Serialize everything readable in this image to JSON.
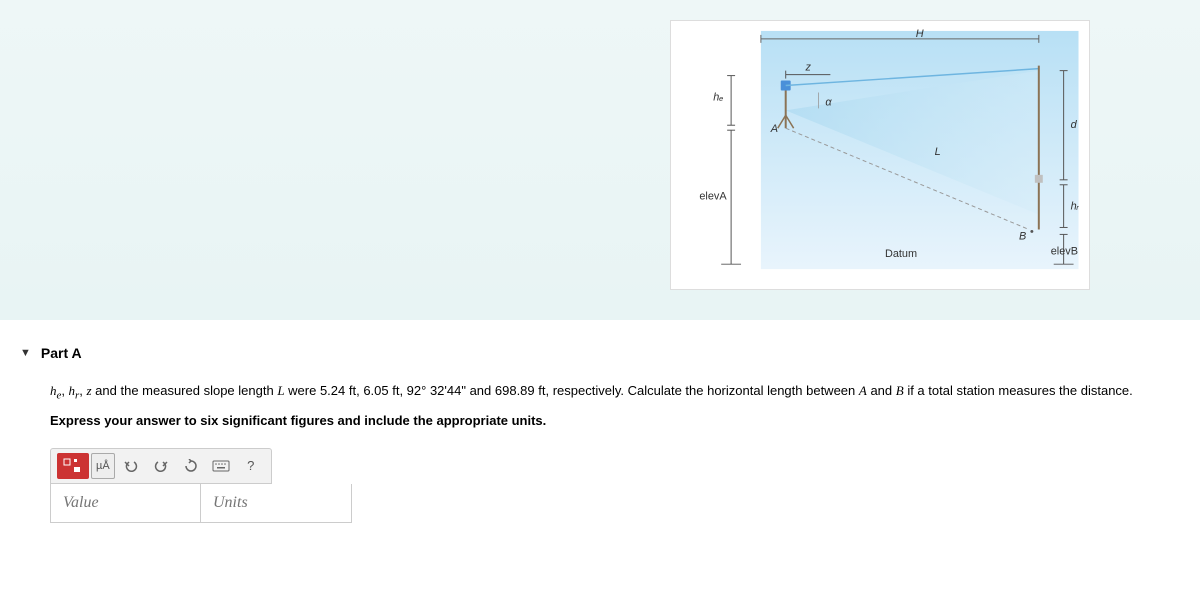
{
  "diagram": {
    "labels": {
      "H": "H",
      "z": "z",
      "alpha": "α",
      "he": "hₑ",
      "A": "A",
      "L": "L",
      "d": "d",
      "hr": "hᵣ",
      "B": "B",
      "elevA": "elevA",
      "elevB": "elevB",
      "Datum": "Datum"
    }
  },
  "part": {
    "title": "Part A",
    "question_prefix": "hₑ, hᵣ, z and the measured slope length L were ",
    "values": "5.24 ft, 6.05 ft, 92° 32'44\" and 698.89 ft",
    "question_suffix": ", respectively. Calculate the horizontal length between A and B if a total station measures the distance.",
    "instruction": "Express your answer to six significant figures and include the appropriate units."
  },
  "toolbar": {
    "special_char": "µÅ",
    "help": "?"
  },
  "inputs": {
    "value_placeholder": "Value",
    "units_placeholder": "Units"
  }
}
